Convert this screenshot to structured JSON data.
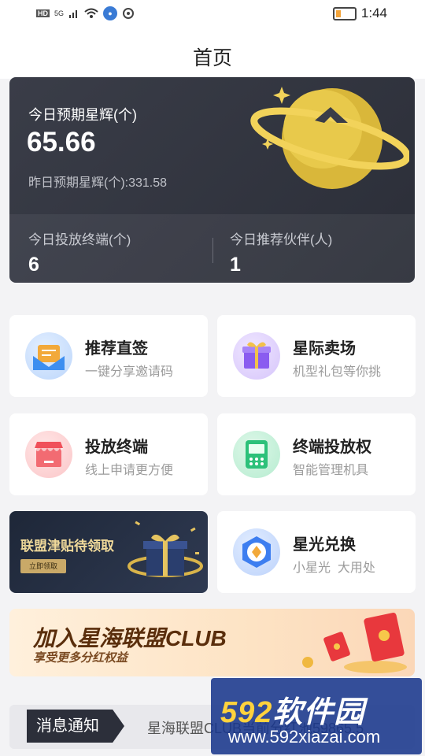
{
  "status_bar": {
    "network_hd": "HD",
    "network_5g": "5G",
    "time": "1:44"
  },
  "header": {
    "title": "首页"
  },
  "hero": {
    "today_label": "今日预期星辉(个)",
    "today_value": "65.66",
    "yesterday_text": "昨日预期星辉(个):331.58",
    "terminals_label": "今日投放终端(个)",
    "terminals_value": "6",
    "partners_label": "今日推荐伙伴(人)",
    "partners_value": "1"
  },
  "cards": [
    {
      "title": "推荐直签",
      "subtitle": "一键分享邀请码",
      "icon": "envelope-icon",
      "color": "#3d8ef0"
    },
    {
      "title": "星际卖场",
      "subtitle": "机型礼包等你挑",
      "icon": "gift-icon",
      "color": "#8a5cf0"
    },
    {
      "title": "投放终端",
      "subtitle": "线上申请更方便",
      "icon": "shop-icon",
      "color": "#f0505a"
    },
    {
      "title": "终端投放权",
      "subtitle": "智能管理机具",
      "icon": "pos-terminal-icon",
      "color": "#2cc17a"
    },
    {
      "title": "星光兑换",
      "subtitle": "小星光  大用处",
      "icon": "exchange-icon",
      "color": "#3d7ef0"
    }
  ],
  "subsidy_banner": {
    "title": "联盟津贴待领取",
    "button": "立即领取"
  },
  "club_banner": {
    "title": "加入星海联盟CLUB",
    "subtitle": "享受更多分红权益"
  },
  "notice": {
    "tag": "消息通知",
    "text": "星海联盟CLUB当前分红池59865.5"
  },
  "watermark": {
    "brand_number": "592",
    "brand_text": "软件园",
    "url": "www.592xiazai.com"
  }
}
